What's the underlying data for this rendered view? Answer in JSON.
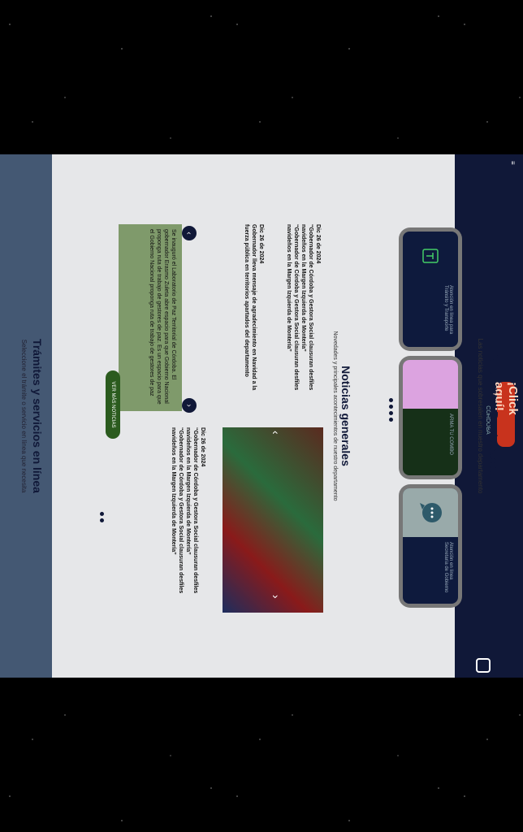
{
  "header": {
    "cta_label": "¡Click aquí!",
    "logo_text": "CÓRDOBA",
    "menu_label": "≡"
  },
  "featured": {
    "title": "Anuncios Destacados",
    "subtitle": "Las noticias que sobresalen en nuestro departamento",
    "cards": [
      {
        "text": "Atención en línea para Tránsito y Transporte"
      },
      {
        "text": "ARMA TU COMBO"
      },
      {
        "text": "Atención en línea Secretaría de Gobierno"
      }
    ]
  },
  "news": {
    "title": "Noticias generales",
    "subtitle": "Novedades y principales acontecimientos de nuestro departamento",
    "items": [
      {
        "date": "Dic 26 de 2024",
        "headline": "“Gobernador de Córdoba y Gestora Social clausuran desfiles navideños en la Margen Izquierda de Montería”",
        "body": "“Gobernador de Córdoba y Gestora Social clausuran desfiles navideños en la Margen Izquierda de Montería”"
      },
      {
        "date": "Dic 26 de 2024",
        "headline": "Gobernador Zuleta: mensaje de agradecimiento en Navidad a la fuerza pública en territorios apartados del departamento",
        "body": "Gobernador lleva mensaje de agradecimiento en Navidad a la fuerza pública en territorios apartados del departamento"
      }
    ],
    "green_box": "Se inauguró el Laboratorio de Paz Territorial de Córdoba. El gobernador Erasmo Zuleta abre espacio para que Gobierno Nacional proponga ruta de trabajo de gestores de paz. Es un espacio para que el Gobierno Nacional proponga ruta de trabajo de gestores de paz",
    "more_button": "VER MÁS NOTICIAS"
  },
  "services": {
    "title": "Trámites y servicios en línea",
    "subtitle": "Seleccione el trámite o servicio en línea que necesita"
  }
}
